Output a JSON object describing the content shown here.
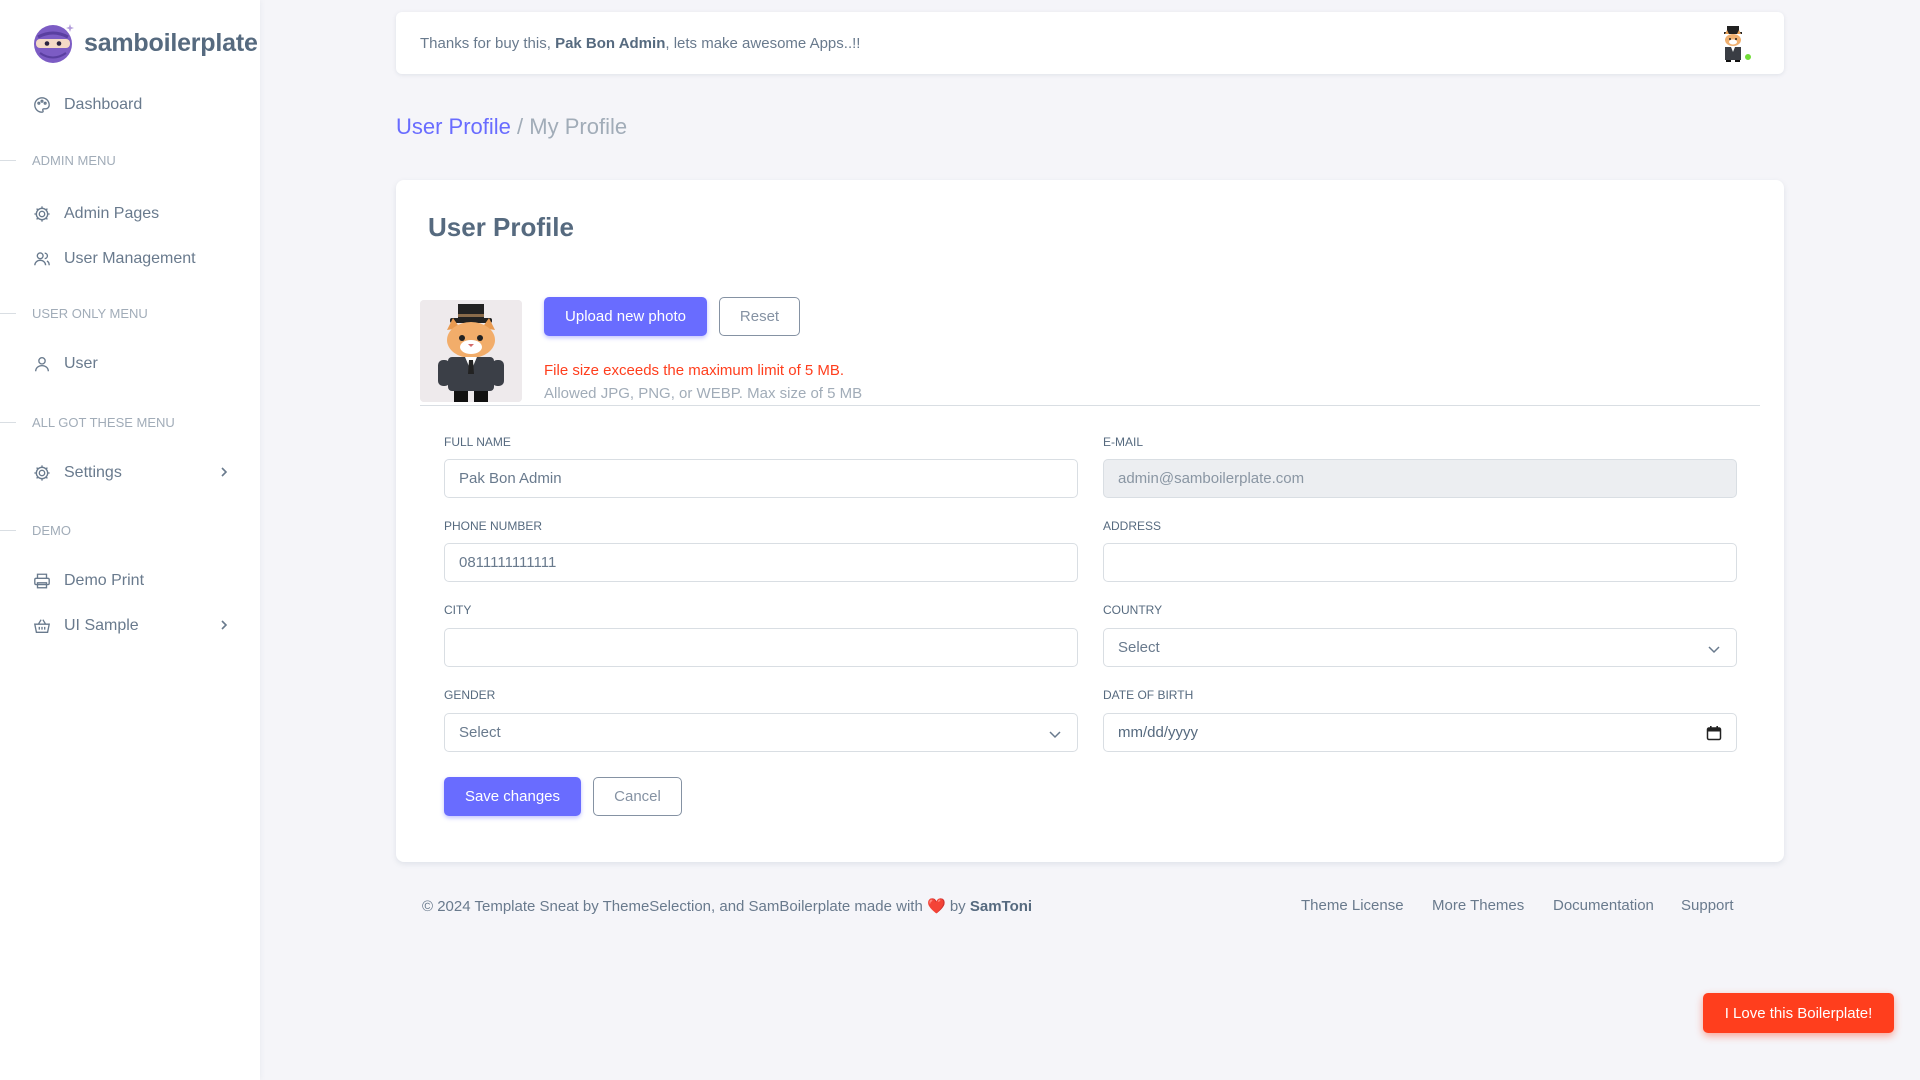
{
  "brand": {
    "name": "samboilerplate",
    "logo_icon": "ninja-logo-icon"
  },
  "sidebar": {
    "dashboard": {
      "label": "Dashboard",
      "icon": "palette-icon"
    },
    "admin_header": "ADMIN MENU",
    "admin_pages": {
      "label": "Admin Pages",
      "icon": "gear-icon"
    },
    "user_management": {
      "label": "User Management",
      "icon": "users-icon"
    },
    "user_only_header": "USER ONLY MENU",
    "user": {
      "label": "User",
      "icon": "user-icon"
    },
    "all_header": "ALL GOT THESE MENU",
    "settings": {
      "label": "Settings",
      "icon": "gear-icon"
    },
    "demo_header": "DEMO",
    "demo_print": {
      "label": "Demo Print",
      "icon": "printer-icon"
    },
    "ui_sample": {
      "label": "UI Sample",
      "icon": "basket-icon"
    }
  },
  "navbar": {
    "thanks_prefix": "Thanks for buy this, ",
    "user_name": "Pak Bon Admin",
    "thanks_suffix": ", lets make awesome Apps..!!"
  },
  "breadcrumb": {
    "parent": "User Profile",
    "separator": "/",
    "current": "My Profile"
  },
  "profile": {
    "card_title": "User Profile",
    "upload_label": "Upload new photo",
    "reset_label": "Reset",
    "error": "File size exceeds the maximum limit of 5 MB.",
    "hint": "Allowed JPG, PNG, or WEBP. Max size of 5 MB",
    "fields": {
      "full_name": {
        "label": "FULL NAME",
        "value": "Pak Bon Admin"
      },
      "email": {
        "label": "E-MAIL",
        "value": "admin@samboilerplate.com"
      },
      "phone": {
        "label": "PHONE NUMBER",
        "value": "0811111111111"
      },
      "address": {
        "label": "ADDRESS",
        "value": ""
      },
      "city": {
        "label": "CITY",
        "value": ""
      },
      "country": {
        "label": "COUNTRY",
        "value": "Select"
      },
      "gender": {
        "label": "GENDER",
        "value": "Select"
      },
      "dob": {
        "label": "DATE OF BIRTH",
        "value": "mm/dd/yyyy"
      }
    },
    "save_label": "Save changes",
    "cancel_label": "Cancel"
  },
  "footer": {
    "text_prefix": "© 2024 Template Sneat by ThemeSelection, and SamBoilerplate made with ",
    "text_by": " by ",
    "author": "SamToni",
    "links": [
      "Theme License",
      "More Themes",
      "Documentation",
      "Support"
    ]
  },
  "love_button": "I Love this Boilerplate!",
  "colors": {
    "primary": "#696cff",
    "danger": "#ff3e1d",
    "online": "#71dd37"
  }
}
